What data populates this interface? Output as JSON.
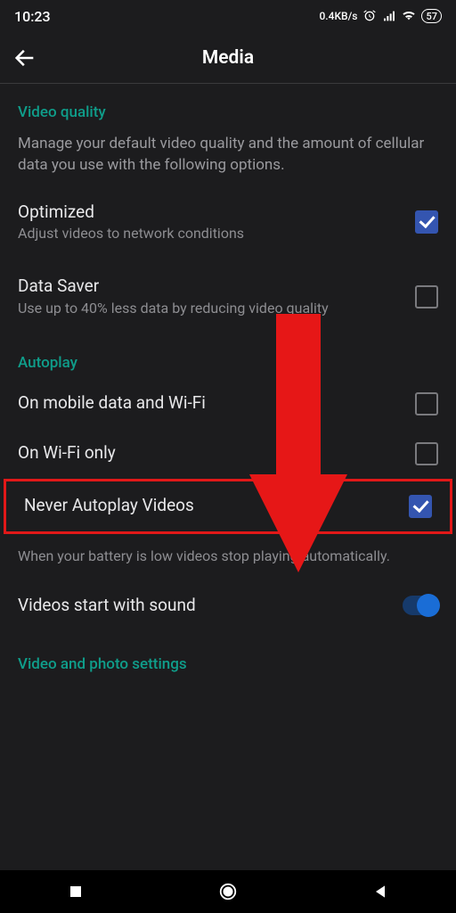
{
  "status": {
    "time": "10:23",
    "network_speed": "0.4KB/s",
    "battery": "57"
  },
  "header": {
    "title": "Media"
  },
  "sections": {
    "video_quality": {
      "header": "Video quality",
      "description": "Manage your default video quality and the amount of cellular data you use with the following options.",
      "options": [
        {
          "title": "Optimized",
          "subtitle": "Adjust videos to network conditions",
          "checked": true
        },
        {
          "title": "Data Saver",
          "subtitle": "Use up to 40% less data by reducing video quality",
          "checked": false
        }
      ]
    },
    "autoplay": {
      "header": "Autoplay",
      "options": [
        {
          "title": "On mobile data and Wi-Fi",
          "checked": false
        },
        {
          "title": "On Wi-Fi only",
          "checked": false
        },
        {
          "title": "Never Autoplay Videos",
          "checked": true
        }
      ],
      "note": "When your battery is low videos stop playing automatically.",
      "sound": {
        "title": "Videos start with sound",
        "enabled": true
      }
    },
    "video_photo": {
      "header": "Video and photo settings"
    }
  }
}
